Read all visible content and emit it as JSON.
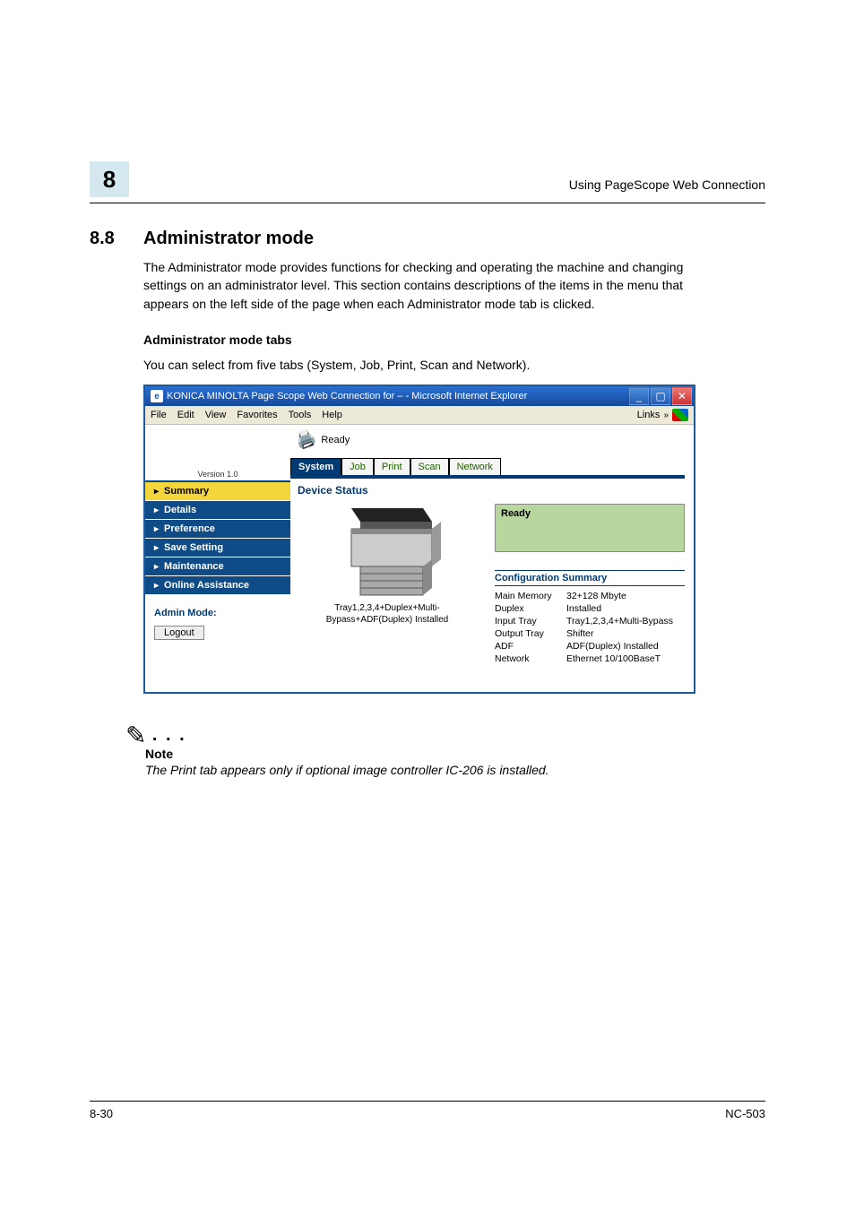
{
  "chapter_number": "8",
  "running_header": "Using PageScope Web Connection",
  "section_number": "8.8",
  "section_title": "Administrator mode",
  "intro_paragraph": "The Administrator mode provides functions for checking and operating the machine and changing settings on an administrator level. This section contains descriptions of the items in the menu that appears on the left side of the page when each Administrator mode tab is clicked.",
  "sub_heading": "Administrator mode tabs",
  "sub_paragraph": "You can select from five tabs (System, Job, Print, Scan and Network).",
  "ie": {
    "title": "KONICA MINOLTA Page Scope Web Connection for  –  - Microsoft Internet Explorer",
    "menu_file": "File",
    "menu_edit": "Edit",
    "menu_view": "View",
    "menu_favorites": "Favorites",
    "menu_tools": "Tools",
    "menu_help": "Help",
    "links_label": "Links"
  },
  "ps": {
    "version_label": "Version 1.0",
    "ready_label": "Ready",
    "tabs": {
      "system": "System",
      "job": "Job",
      "print": "Print",
      "scan": "Scan",
      "network": "Network"
    },
    "nav": {
      "summary": "Summary",
      "details": "Details",
      "preference": "Preference",
      "save_setting": "Save Setting",
      "maintenance": "Maintenance",
      "online_assistance": "Online Assistance"
    },
    "admin_mode_label": "Admin Mode:",
    "logout_label": "Logout",
    "device_status_title": "Device Status",
    "tray_text_line1": "Tray1,2,3,4+Duplex+Multi-",
    "tray_text_line2": "Bypass+ADF(Duplex) Installed",
    "status_ready": "Ready",
    "conf_summary_title": "Configuration Summary",
    "conf": {
      "main_memory_key": "Main Memory",
      "main_memory_val": "32+128 Mbyte",
      "duplex_key": "Duplex",
      "duplex_val": "Installed",
      "input_tray_key": "Input Tray",
      "input_tray_val": "Tray1,2,3,4+Multi-Bypass",
      "output_tray_key": "Output Tray",
      "output_tray_val": "Shifter",
      "adf_key": "ADF",
      "adf_val": "ADF(Duplex) Installed",
      "network_key": "Network",
      "network_val": "Ethernet 10/100BaseT"
    }
  },
  "note": {
    "dots": ". . .",
    "label": "Note",
    "text": "The Print tab appears only if optional image controller IC-206 is installed."
  },
  "footer_page": "8-30",
  "footer_model": "NC-503"
}
